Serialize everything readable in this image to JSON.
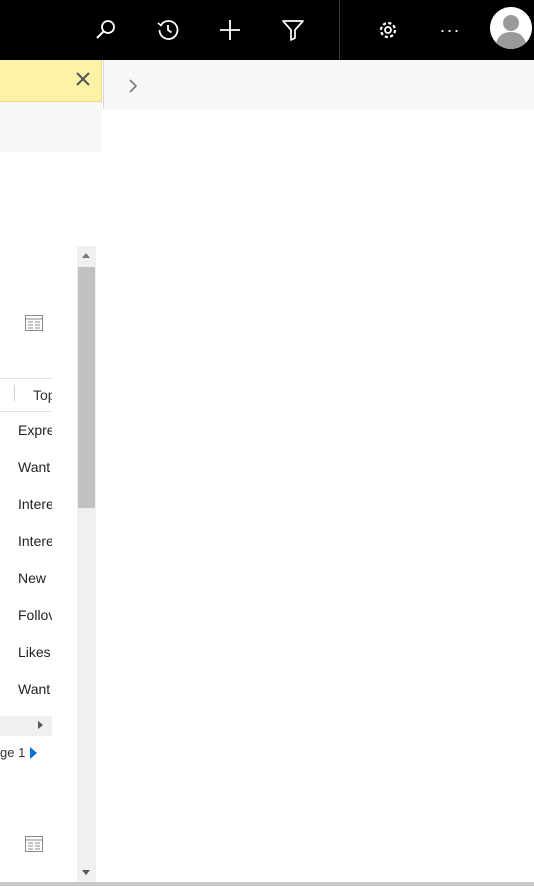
{
  "topbar": {
    "icons": [
      "search-icon",
      "recent-history-icon",
      "new-plus-icon",
      "advanced-filter-icon",
      "settings-gear-icon",
      "more-ellipsis-icon",
      "user-avatar-icon"
    ],
    "more_label": "···",
    "background": "#000000"
  },
  "notification": {
    "background": "#fdf3a7",
    "close_icon": "close-icon"
  },
  "right_panel": {
    "expand_icon": "chevron-right-icon"
  },
  "list": {
    "column_header": "Top",
    "rows": [
      "Expre",
      "Want",
      "Intere",
      "Intere",
      "New",
      "Follov",
      "Likes",
      "Want"
    ]
  },
  "pager": {
    "text": "ge 1",
    "next_icon": "next-page-arrow-icon"
  },
  "colors": {
    "accent_blue": "#0a6fd6",
    "scroll_track": "#f0f0f0",
    "scroll_thumb": "#c1c1c1"
  }
}
